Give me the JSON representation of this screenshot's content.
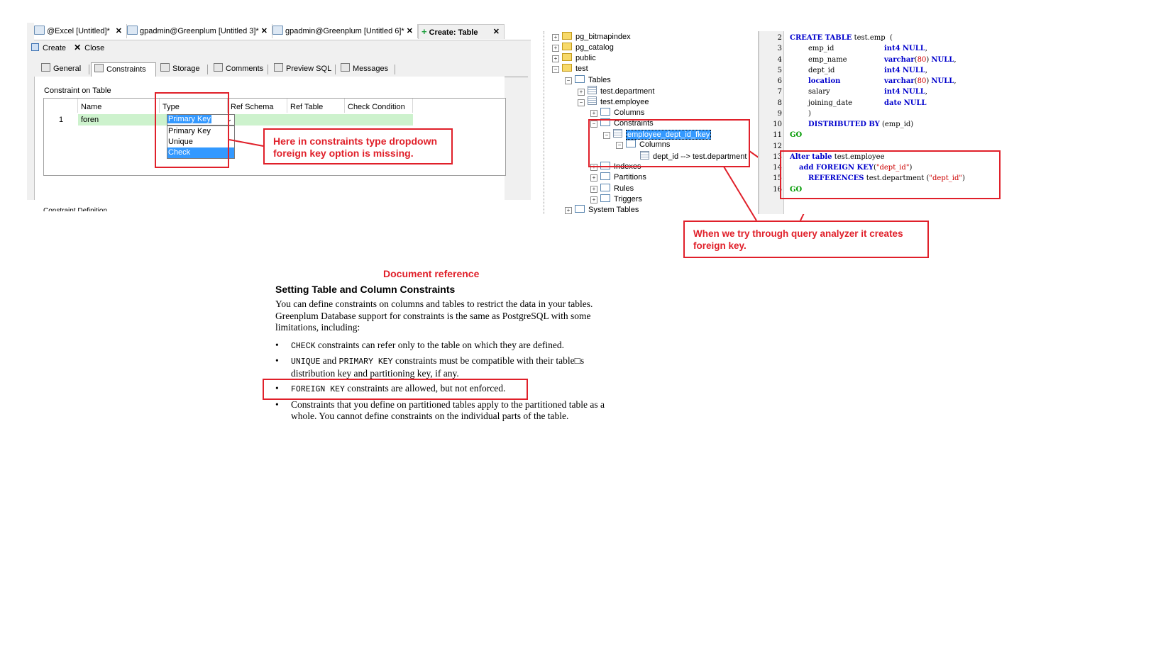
{
  "left_panel": {
    "doc_tabs": [
      {
        "label": "@Excel [Untitled]*"
      },
      {
        "label": "gpadmin@Greenplum [Untitled 3]*"
      },
      {
        "label": "gpadmin@Greenplum [Untitled 6]*"
      },
      {
        "label": "Create: Table"
      }
    ],
    "close_glyph": "✕",
    "toolbar": {
      "create_label": "Create",
      "close_label": "Close"
    },
    "sub_tabs": [
      "General",
      "Constraints",
      "Storage",
      "Comments",
      "Preview SQL",
      "Messages"
    ],
    "section_label": "Constraint on Table",
    "grid": {
      "columns": [
        "Name",
        "Type",
        "Ref Schema",
        "Ref Table",
        "Check Condition"
      ],
      "row": {
        "index": "1",
        "name": "foren",
        "type": "Primary Key"
      }
    },
    "dropdown": {
      "selected": "Primary Key",
      "options": [
        "Primary Key",
        "Unique",
        "Check"
      ],
      "highlighted_option": "Check"
    },
    "cut_label": "Constraint Definition"
  },
  "tree": {
    "nodes": [
      {
        "label": "pg_bitmapindex",
        "icon": "schema-icon",
        "toggle": "+"
      },
      {
        "label": "pg_catalog",
        "icon": "schema-icon",
        "toggle": "+"
      },
      {
        "label": "public",
        "icon": "schema-icon",
        "toggle": "+"
      },
      {
        "label": "test",
        "icon": "schema-icon",
        "toggle": "−"
      },
      {
        "label": "Tables",
        "icon": "folder-icon",
        "toggle": "−"
      },
      {
        "label": "test.department",
        "icon": "table-icon",
        "toggle": "+"
      },
      {
        "label": "test.employee",
        "icon": "table-icon",
        "toggle": "−"
      },
      {
        "label": "Columns",
        "icon": "folder-icon",
        "toggle": "+"
      },
      {
        "label": "Constraints",
        "icon": "folder-icon",
        "toggle": "−"
      },
      {
        "label": "employee_dept_id_fkey",
        "icon": "key-icon",
        "toggle": "−"
      },
      {
        "label": "Columns",
        "icon": "folder-icon",
        "toggle": "−"
      },
      {
        "label": "dept_id --> test.department",
        "icon": "table-icon",
        "toggle": ""
      },
      {
        "label": "Indexes",
        "icon": "folder-icon",
        "toggle": "+"
      },
      {
        "label": "Partitions",
        "icon": "folder-icon",
        "toggle": "+"
      },
      {
        "label": "Rules",
        "icon": "folder-icon",
        "toggle": "+"
      },
      {
        "label": "Triggers",
        "icon": "folder-icon",
        "toggle": "+"
      },
      {
        "label": "System Tables",
        "icon": "folder-icon",
        "toggle": "+"
      }
    ]
  },
  "editor": {
    "line_numbers": [
      "2",
      "3",
      "4",
      "5",
      "6",
      "7",
      "8",
      "9",
      "10",
      "11",
      "12",
      "13",
      "14",
      "15",
      "16"
    ],
    "lines": {
      "l2": [
        "CREATE TABLE",
        " test.emp  ("
      ],
      "l3": [
        "emp_id",
        "int4",
        "NULL",
        ","
      ],
      "l4": [
        "emp_name",
        "varchar",
        "(",
        "80",
        ")",
        "NULL",
        ","
      ],
      "l5": [
        "dept_id",
        "int4",
        "NULL",
        ","
      ],
      "l6": [
        "location",
        "varchar",
        "(",
        "80",
        ")",
        "NULL",
        ","
      ],
      "l7": [
        "salary",
        "int4",
        "NULL",
        ","
      ],
      "l8": [
        "joining_date",
        "date",
        "NULL"
      ],
      "l9": [
        ")"
      ],
      "l10": [
        "DISTRIBUTED BY",
        " (emp_id)"
      ],
      "l11": [
        "GO"
      ],
      "l13": [
        "Alter table",
        " test.employee"
      ],
      "l14": [
        "add FOREIGN KEY",
        "(",
        "\"dept_id\"",
        ")"
      ],
      "l15": [
        "REFERENCES",
        " test.department (",
        "\"dept_id\"",
        ")"
      ],
      "l16": [
        "GO"
      ]
    }
  },
  "annotations": {
    "callout1": [
      "Here in constraints type dropdown",
      "foreign key option is missing."
    ],
    "callout2": [
      "When we try through query analyzer it creates",
      "foreign key."
    ]
  },
  "document": {
    "title": "Document reference",
    "heading": "Setting Table and Column Constraints",
    "paragraph": "You can define constraints on columns and tables to restrict the data in your tables. Greenplum Database support for constraints is the same as PostgreSQL with some limitations, including:",
    "bullet_glyph": "•",
    "bullets": [
      {
        "code": "CHECK",
        "text": " constraints can refer only to the table on which they are defined."
      },
      {
        "code": "UNIQUE",
        "mid": " and ",
        "code2": "PRIMARY KEY",
        "text": " constraints must be compatible with their table□s distribution key and partitioning key, if any."
      },
      {
        "code": "FOREIGN KEY",
        "text": " constraints are allowed, but not enforced."
      },
      {
        "code": "",
        "text": "Constraints that you define on partitioned tables apply to the partitioned table as a whole. You cannot define constraints on the individual parts of the table."
      }
    ]
  },
  "colors": {
    "annotation_red": "#e0202a",
    "selection_blue": "#3399ff",
    "row_green": "#cdf2cd",
    "keyword_blue": "#0000cc"
  }
}
